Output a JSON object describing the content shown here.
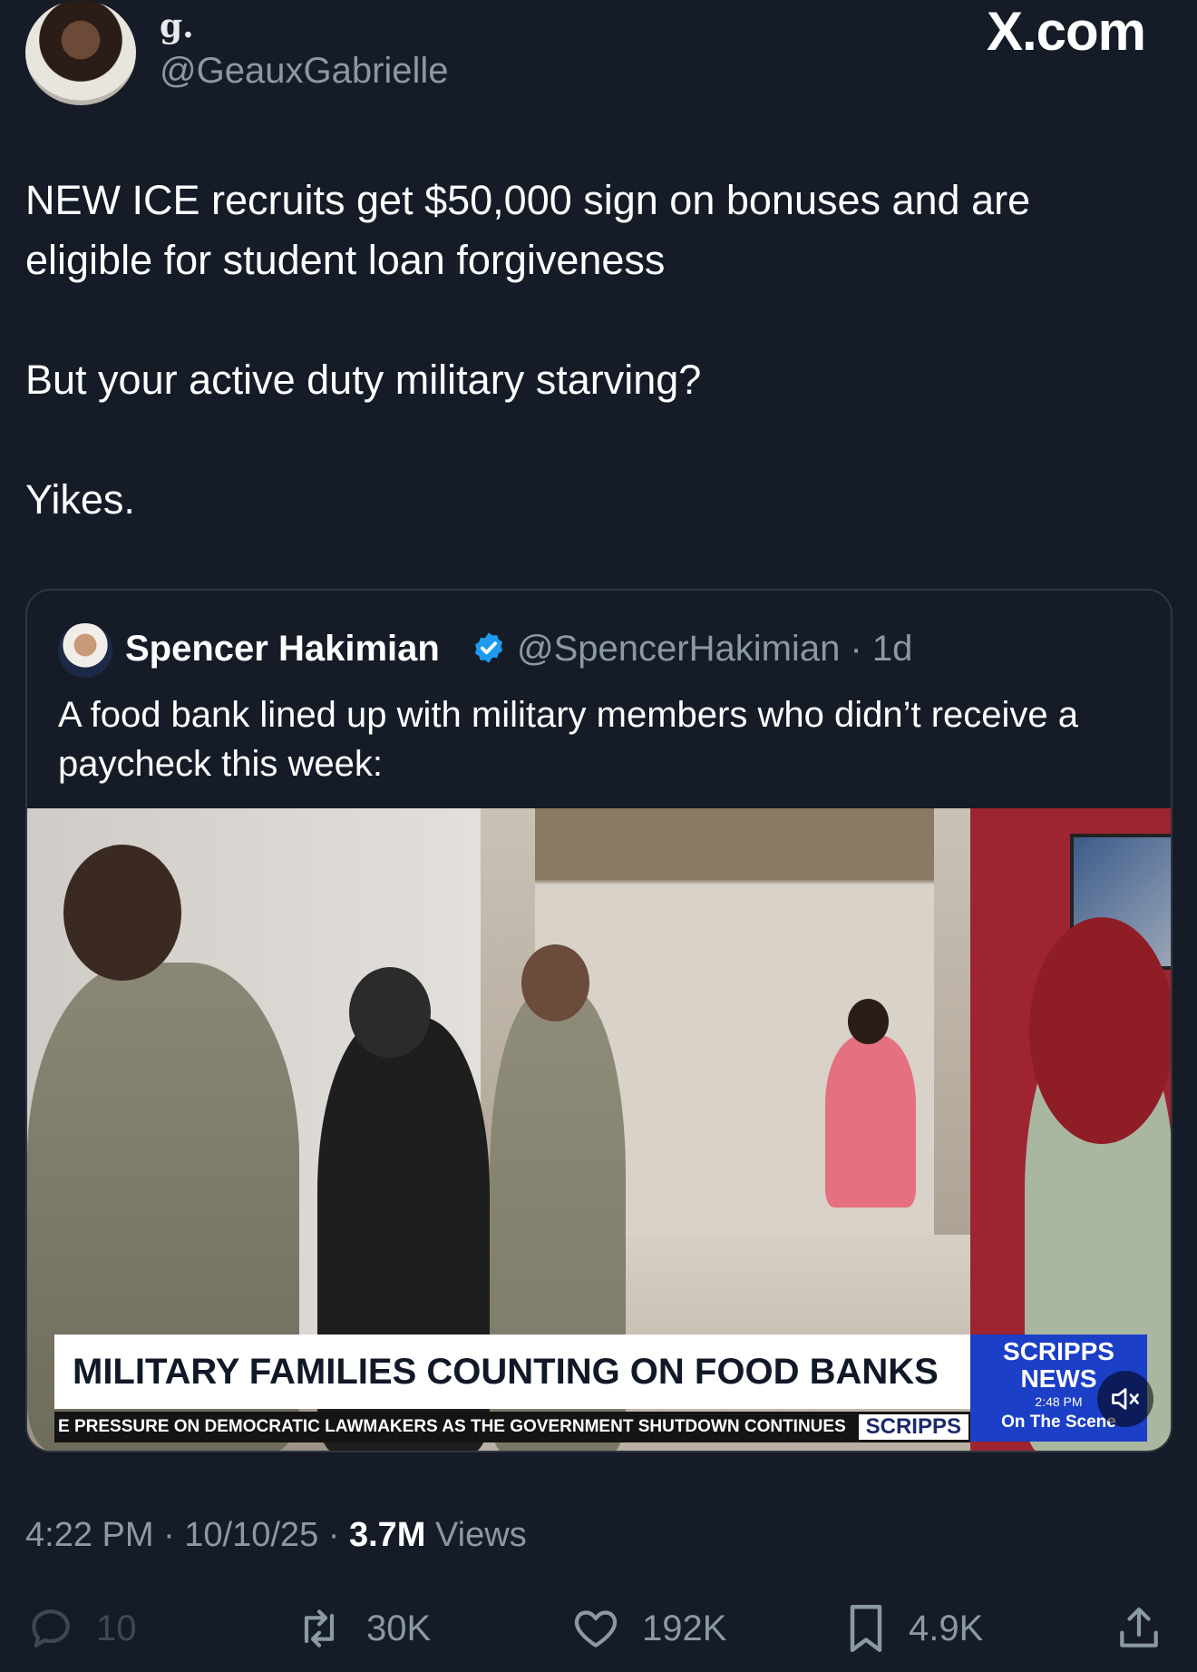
{
  "header": {
    "display_name": "g.",
    "handle": "@GeauxGabrielle",
    "watermark": "X.com"
  },
  "tweet": {
    "paragraphs": [
      "NEW ICE recruits get $50,000 sign on bonuses and are eligible for student loan forgiveness",
      "But your active duty military starving?",
      "Yikes."
    ]
  },
  "quote": {
    "name": "Spencer Hakimian",
    "handle_time": "@SpencerHakimian · 1d",
    "text": "A food bank lined up with military members who didn’t receive a paycheck this week:",
    "video": {
      "headline": "MILITARY FAMILIES COUNTING ON FOOD BANKS",
      "ticker": "E PRESSURE ON DEMOCRATIC LAWMAKERS AS THE GOVERNMENT SHUTDOWN CONTINUES",
      "ticker_brand": "SCRIPPS",
      "logo_line1": "SCRIPPS",
      "logo_line2": "NEWS",
      "logo_time": "2:48 PM",
      "logo_sub": "On The Scene"
    }
  },
  "meta": {
    "time_date": "4:22 PM · 10/10/25 · ",
    "views_count": "3.7M",
    "views_label": " Views"
  },
  "actions": {
    "replies": "10",
    "reposts": "30K",
    "likes": "192K",
    "bookmarks": "4.9K"
  },
  "colors": {
    "background": "#151c28",
    "secondary_text": "#8b98a5",
    "verified": "#1d9bf0",
    "scripps_blue": "#1c3fc7"
  }
}
